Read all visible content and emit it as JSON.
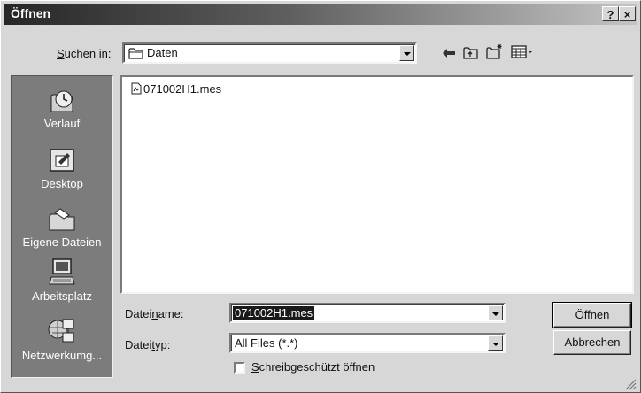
{
  "window": {
    "title": "Öffnen",
    "help_label": "?",
    "close_label": "×"
  },
  "lookin": {
    "label_pre": "S",
    "label_rest": "uchen in:",
    "value": "Daten"
  },
  "places": [
    {
      "label": "Verlauf",
      "icon": "history-icon"
    },
    {
      "label": "Desktop",
      "icon": "desktop-icon"
    },
    {
      "label": "Eigene Dateien",
      "icon": "my-documents-icon"
    },
    {
      "label": "Arbeitsplatz",
      "icon": "my-computer-icon"
    },
    {
      "label": "Netzwerkumg...",
      "icon": "network-icon"
    }
  ],
  "files": [
    {
      "name": "071002H1.mes",
      "icon": "file-icon"
    }
  ],
  "filename": {
    "label_a": "Datei",
    "label_u": "n",
    "label_b": "ame:",
    "value": "071002H1.mes"
  },
  "filetype": {
    "label_a": "Datei",
    "label_u": "t",
    "label_b": "yp:",
    "value": "All Files (*.*)"
  },
  "readonly": {
    "label_u": "S",
    "label_rest": "chreibgeschützt öffnen",
    "checked": false
  },
  "buttons": {
    "open": "Öffnen",
    "cancel": "Abbrechen"
  }
}
